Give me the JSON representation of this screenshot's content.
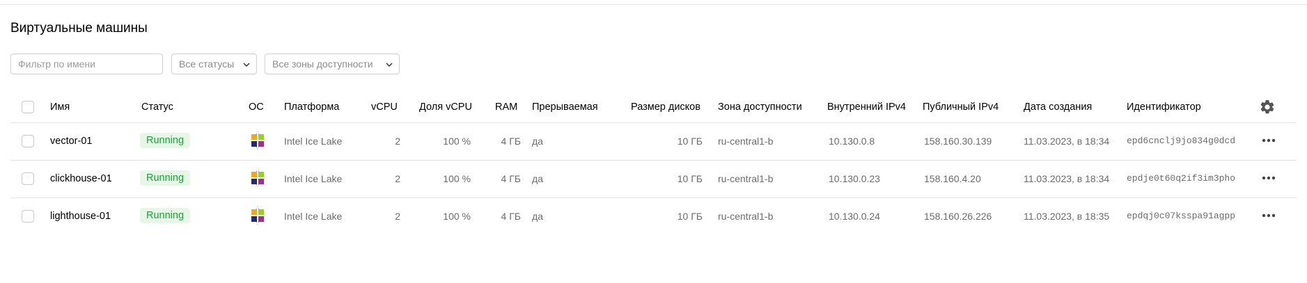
{
  "page": {
    "title": "Виртуальные машины"
  },
  "filters": {
    "name_placeholder": "Фильтр по имени",
    "status_select": "Все статусы",
    "zone_select": "Все зоны доступности"
  },
  "table": {
    "columns": {
      "name": "Имя",
      "status": "Статус",
      "os": "ОС",
      "platform": "Платформа",
      "vcpu": "vCPU",
      "vcpu_share": "Доля vCPU",
      "ram": "RAM",
      "preemptible": "Прерываемая",
      "disk_size": "Размер дисков",
      "zone": "Зона доступности",
      "internal_ip": "Внутренний IPv4",
      "public_ip": "Публичный IPv4",
      "created": "Дата создания",
      "id": "Идентификатор"
    },
    "rows": [
      {
        "name": "vector-01",
        "status": "Running",
        "os_icon": "centos-icon",
        "platform": "Intel Ice Lake",
        "vcpu": "2",
        "vcpu_share": "100 %",
        "ram": "4 ГБ",
        "preemptible": "да",
        "disk_size": "10 ГБ",
        "zone": "ru-central1-b",
        "internal_ip": "10.130.0.8",
        "public_ip": "158.160.30.139",
        "created": "11.03.2023, в 18:34",
        "id": "epd6cnclj9jo834g0dcd"
      },
      {
        "name": "clickhouse-01",
        "status": "Running",
        "os_icon": "centos-icon",
        "platform": "Intel Ice Lake",
        "vcpu": "2",
        "vcpu_share": "100 %",
        "ram": "4 ГБ",
        "preemptible": "да",
        "disk_size": "10 ГБ",
        "zone": "ru-central1-b",
        "internal_ip": "10.130.0.23",
        "public_ip": "158.160.4.20",
        "created": "11.03.2023, в 18:34",
        "id": "epdje0t60q2if3im3pho"
      },
      {
        "name": "lighthouse-01",
        "status": "Running",
        "os_icon": "centos-icon",
        "platform": "Intel Ice Lake",
        "vcpu": "2",
        "vcpu_share": "100 %",
        "ram": "4 ГБ",
        "preemptible": "да",
        "disk_size": "10 ГБ",
        "zone": "ru-central1-b",
        "internal_ip": "10.130.0.24",
        "public_ip": "158.160.26.226",
        "created": "11.03.2023, в 18:35",
        "id": "epdqj0c07ksspa91agpp"
      }
    ]
  },
  "colors": {
    "status_running_text": "#1f9d3a",
    "status_running_bg": "#e7f7e7",
    "border": "#e3e3e3",
    "muted_text": "#6b6b6b"
  },
  "icons": {
    "settings": "gear-icon",
    "row_actions": "more-horizontal-icon",
    "dropdown": "chevron-down-icon",
    "os": "centos-icon"
  }
}
